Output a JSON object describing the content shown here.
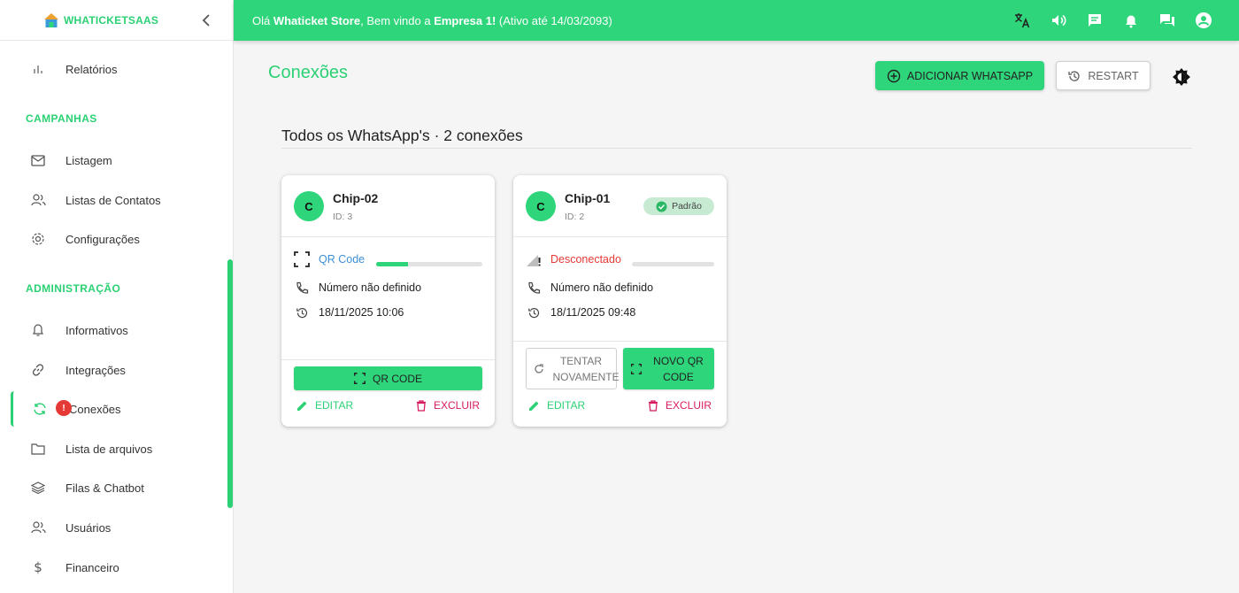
{
  "app": {
    "logo_text": "WHATICKETSAAS"
  },
  "topbar": {
    "greeting_prefix": "Olá ",
    "user": "Whaticket Store",
    "greeting_mid": ", Bem vindo a ",
    "company": "Empresa 1!",
    "greeting_suffix": " (Ativo até 14/03/2093)"
  },
  "sidebar": {
    "items": {
      "relatorios": "Relatórios",
      "listagem": "Listagem",
      "listas_contatos": "Listas de Contatos",
      "configuracoes": "Configurações",
      "informativos": "Informativos",
      "integracoes": "Integrações",
      "conexoes": "Conexões",
      "lista_arquivos": "Lista de arquivos",
      "filas_chatbot": "Filas & Chatbot",
      "usuarios": "Usuários",
      "financeiro": "Financeiro"
    },
    "sections": {
      "campanhas": "CAMPANHAS",
      "administracao": "ADMINISTRAÇÃO"
    },
    "conexoes_badge": "!"
  },
  "main": {
    "title": "Conexões",
    "add_button": "ADICIONAR WHATSAPP",
    "restart_button": "RESTART",
    "section_heading": "Todos os WhatsApp's · 2 conexões"
  },
  "cards": [
    {
      "avatar": "C",
      "name": "Chip-02",
      "id": "ID: 3",
      "status": "QR Code",
      "progress": 0.3,
      "number": "Número não definido",
      "datetime": "18/11/2025 10:06",
      "qr_button": "QR CODE",
      "edit": "EDITAR",
      "delete": "EXCLUIR"
    },
    {
      "avatar": "C",
      "name": "Chip-01",
      "id": "ID: 2",
      "default_chip": "Padrão",
      "status": "Desconectado",
      "progress": 0,
      "number": "Número não definido",
      "datetime": "18/11/2025 09:48",
      "retry_button": "TENTAR NOVAMENTE",
      "new_qr_button": "NOVO QR CODE",
      "edit": "EDITAR",
      "delete": "EXCLUIR"
    }
  ],
  "colors": {
    "brand": "#2ed57a",
    "danger": "#e53935",
    "delete": "#d81b60",
    "qr_status": "#3d8fd6"
  }
}
